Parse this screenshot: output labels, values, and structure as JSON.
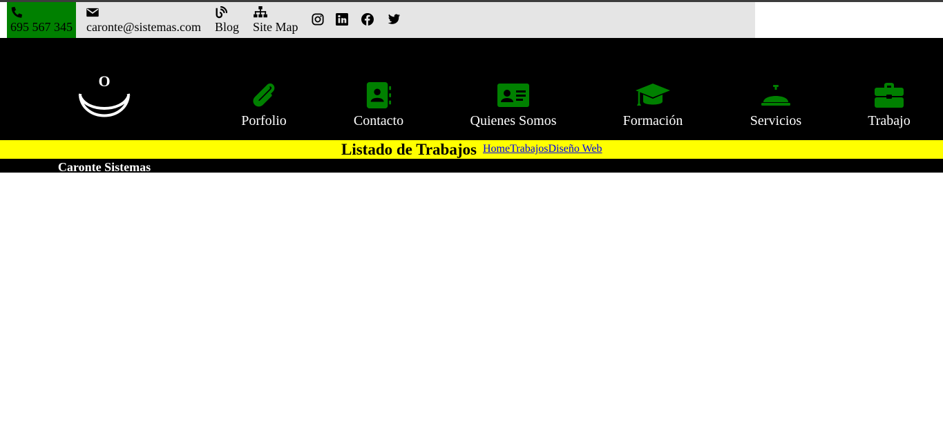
{
  "topbar": {
    "phone": "695 567 345",
    "email": "caronte@sistemas.com",
    "blog": "Blog",
    "sitemap": "Site Map",
    "social": [
      "instagram-icon",
      "linkedin-icon",
      "facebook-icon",
      "twitter-icon"
    ],
    "colors": {
      "background": "#e5e5e5",
      "phone_background": "#008000"
    }
  },
  "brand": {
    "logo_letter": "O",
    "name": "Caronte Sistemas"
  },
  "nav": {
    "items": [
      {
        "label": "Porfolio",
        "icon": "paperclip-icon"
      },
      {
        "label": "Contacto",
        "icon": "address-book-icon"
      },
      {
        "label": "Quienes Somos",
        "icon": "id-card-icon"
      },
      {
        "label": "Formación",
        "icon": "graduation-cap-icon"
      },
      {
        "label": "Servicios",
        "icon": "concierge-bell-icon"
      },
      {
        "label": "Trabajo",
        "icon": "briefcase-icon"
      }
    ],
    "icon_color": "#008000"
  },
  "page": {
    "title": "Listado de Trabajos",
    "breadcrumbs": [
      "Home",
      "Trabajos",
      "Diseño Web"
    ],
    "bar_color": "#ffff00"
  }
}
